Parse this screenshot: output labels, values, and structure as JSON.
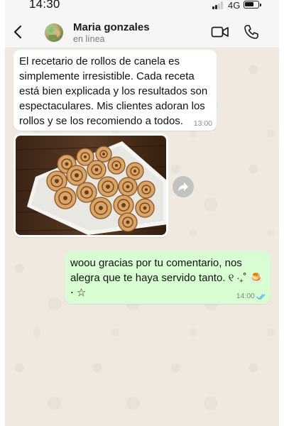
{
  "status_bar": {
    "time": "14:30",
    "network": "4G"
  },
  "header": {
    "contact_name": "Maria gonzales",
    "contact_status": "en línea",
    "icons": [
      "back-arrow-icon",
      "avatar",
      "video-call-icon",
      "phone-call-icon"
    ]
  },
  "messages": [
    {
      "direction": "incoming",
      "type": "text",
      "text": "El recetario de rollos de canela es simplemente irresistible. Cada receta está bien explicada y los resultados son espectaculares. Mis clientes adoran los rollos y se los recomiendo a todos.",
      "time": "13:00"
    },
    {
      "direction": "incoming",
      "type": "image",
      "image_subject": "cinnamon rolls on a white plate over a wooden table"
    },
    {
      "direction": "outgoing",
      "type": "text",
      "text": "woou gracias por tu comentario, nos alegra que te haya servido tanto. ୧ ‧₊˚ 🍮 ⋅ ☆",
      "time": "14:00",
      "read": true
    }
  ],
  "colors": {
    "outgoing_bubble": "#d9fdd3",
    "incoming_bubble": "#ffffff",
    "chat_background": "#efe9df",
    "read_ticks": "#53bdeb"
  }
}
